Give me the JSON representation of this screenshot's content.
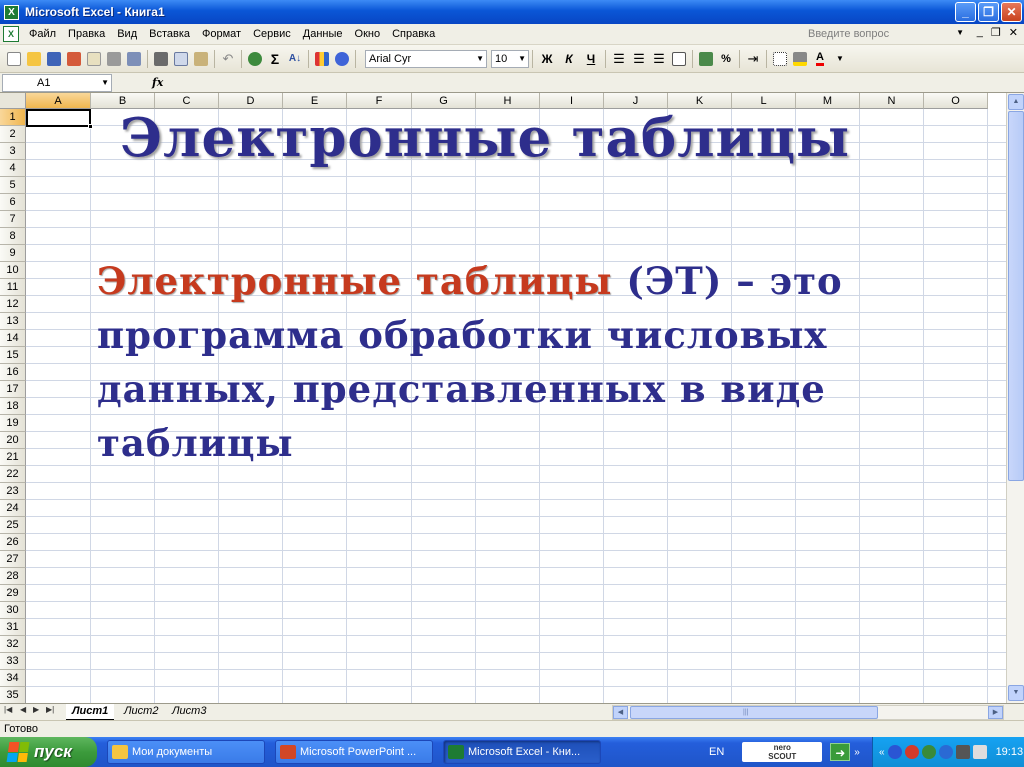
{
  "window": {
    "title": "Microsoft Excel - Книга1",
    "app_icon": "X",
    "minimize": "_",
    "restore": "❐",
    "close": "✕"
  },
  "menu": {
    "items": [
      "Файл",
      "Правка",
      "Вид",
      "Вставка",
      "Формат",
      "Сервис",
      "Данные",
      "Окно",
      "Справка"
    ],
    "help_placeholder": "Введите вопрос",
    "doc_min": "_",
    "doc_restore": "❐",
    "doc_close": "✕"
  },
  "toolbar": {
    "font_name": "Arial Cyr",
    "font_size": "10",
    "bold": "Ж",
    "italic": "К",
    "underline": "Ч",
    "sum": "Σ",
    "percent": "%"
  },
  "formula_bar": {
    "name_box": "A1",
    "fx": "fx",
    "content": ""
  },
  "grid": {
    "columns": [
      "A",
      "B",
      "C",
      "D",
      "E",
      "F",
      "G",
      "H",
      "I",
      "J",
      "K",
      "L",
      "M",
      "N",
      "O"
    ],
    "rows": [
      "1",
      "2",
      "3",
      "4",
      "5",
      "6",
      "7",
      "8",
      "9",
      "10",
      "11",
      "12",
      "13",
      "14",
      "15",
      "16",
      "17",
      "18",
      "19",
      "20",
      "21",
      "22",
      "23",
      "24",
      "25",
      "26",
      "27",
      "28",
      "29",
      "30",
      "31",
      "32",
      "33",
      "34",
      "35"
    ],
    "active_column": "A",
    "active_row": "1"
  },
  "slide": {
    "title": "Электронные таблицы",
    "term": "Электронные таблицы",
    "definition": " (ЭТ) – это программа обработки числовых данных, представленных в виде таблицы"
  },
  "sheet_tabs": {
    "tabs": [
      "Лист1",
      "Лист2",
      "Лист3"
    ],
    "active": "Лист1"
  },
  "status": {
    "text": "Готово"
  },
  "taskbar": {
    "start_label": "пуск",
    "buttons": [
      {
        "label": "Мои документы",
        "icon": "folder-icon"
      },
      {
        "label": "Microsoft PowerPoint ...",
        "icon": "powerpoint-icon"
      },
      {
        "label": "Microsoft Excel - Кни...",
        "icon": "excel-icon"
      }
    ],
    "language": "EN",
    "nero_top": "nero",
    "nero_bottom": "SCOUT",
    "clock": "19:13"
  },
  "colors": {
    "title_text": "#2e2e8c",
    "term_text": "#c63a1e",
    "titlebar": "#0a56d6",
    "start_button": "#3c9b3c"
  }
}
